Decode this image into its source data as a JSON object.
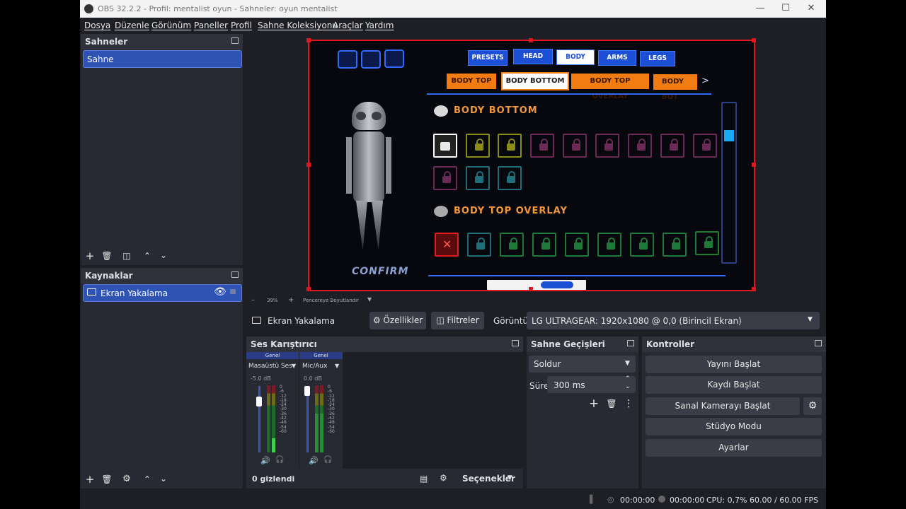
{
  "window": {
    "title": "OBS 32.2.2 - Profil: mentalist oyun - Sahneler: oyun mentalist"
  },
  "menu": [
    "Dosya",
    "Düzenle",
    "Görünüm",
    "Paneller",
    "Profil",
    "Sahne Koleksiyonu",
    "Araçlar",
    "Yardım"
  ],
  "scenes": {
    "title": "Sahneler",
    "items": [
      "Sahne"
    ]
  },
  "sources": {
    "title": "Kaynaklar",
    "items": [
      "Ekran Yakalama"
    ]
  },
  "preview": {
    "zoom": "39%",
    "fit_label": "Pencereye Boyutlandır",
    "game": {
      "tabs": [
        "PRESETS",
        "HEAD",
        "BODY",
        "ARMS",
        "LEGS"
      ],
      "subtabs": [
        "BODY TOP",
        "BODY BOTTOM",
        "BODY TOP OVERLAY",
        "BODY BOT"
      ],
      "next_arrow": ">",
      "section1": "BODY BOTTOM",
      "section2": "BODY TOP OVERLAY",
      "confirm": "CONFIRM"
    }
  },
  "source_bar": {
    "source_name": "Ekran Yakalama",
    "properties": "Özellikler",
    "filters": "Filtreler",
    "display_label": "Görüntü",
    "display_value": "LG ULTRAGEAR: 1920x1080 @ 0,0 (Birincil Ekran)"
  },
  "mixer": {
    "title": "Ses Karıştırıcı",
    "channels": [
      {
        "group": "Genel",
        "name": "Masaüstü Ses",
        "db": "-5.0 dB"
      },
      {
        "group": "Genel",
        "name": "Mic/Aux",
        "db": "0.0 dB"
      }
    ],
    "scale": [
      "0",
      "-6",
      "-12",
      "-18",
      "-24",
      "-30",
      "-36",
      "-42",
      "-48",
      "-54",
      "-60"
    ],
    "hidden": "0 gizlendi",
    "options": "Seçenekler"
  },
  "transitions": {
    "title": "Sahne Geçişleri",
    "type": "Soldur",
    "duration_label": "Süre",
    "duration": "300 ms"
  },
  "controls": {
    "title": "Kontroller",
    "buttons": [
      "Yayını Başlat",
      "Kaydı Başlat",
      "Sanal Kamerayı Başlat",
      "Stüdyo Modu",
      "Ayarlar"
    ]
  },
  "status": {
    "stream_time": "00:00:00",
    "rec_time": "00:00:00",
    "cpu": "CPU: 0,7%",
    "fps": "60.00 / 60.00 FPS"
  },
  "colors": {
    "accent": "#2f53b5",
    "recording_red": "#e0181e",
    "game_orange": "#f27b12",
    "game_blue": "#1d4fd6"
  }
}
